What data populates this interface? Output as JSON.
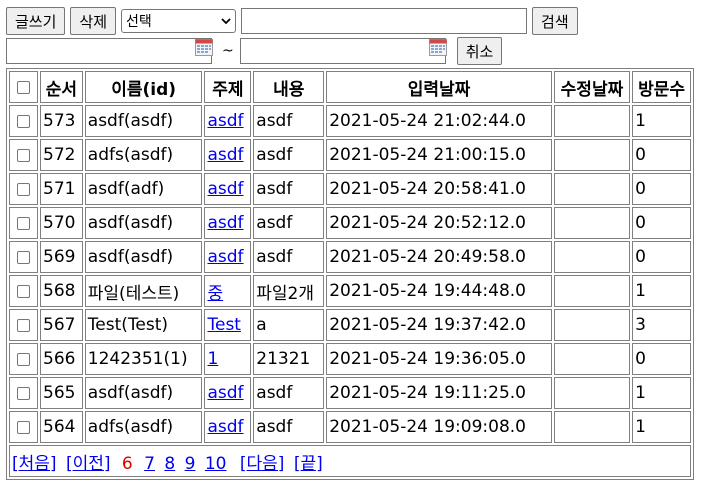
{
  "toolbar": {
    "write_label": "글쓰기",
    "delete_label": "삭제",
    "select_value": "선택",
    "search_value": "",
    "search_label": "검색",
    "cancel_label": "취소",
    "date_from": "",
    "date_to": "",
    "tilde": "~"
  },
  "table": {
    "headers": {
      "no": "순서",
      "name": "이름(id)",
      "subject": "주제",
      "content": "내용",
      "created": "입력날짜",
      "modified": "수정날짜",
      "views": "방문수"
    },
    "rows": [
      {
        "no": "573",
        "name": "asdf(asdf)",
        "subject": "asdf",
        "content": "asdf",
        "created": "2021-05-24 21:02:44.0",
        "modified": "",
        "views": "1"
      },
      {
        "no": "572",
        "name": "adfs(asdf)",
        "subject": "asdf",
        "content": "asdf",
        "created": "2021-05-24 21:00:15.0",
        "modified": "",
        "views": "0"
      },
      {
        "no": "571",
        "name": "asdf(adf)",
        "subject": "asdf",
        "content": "asdf",
        "created": "2021-05-24 20:58:41.0",
        "modified": "",
        "views": "0"
      },
      {
        "no": "570",
        "name": "asdf(asdf)",
        "subject": "asdf",
        "content": "asdf",
        "created": "2021-05-24 20:52:12.0",
        "modified": "",
        "views": "0"
      },
      {
        "no": "569",
        "name": "asdf(asdf)",
        "subject": "asdf",
        "content": "asdf",
        "created": "2021-05-24 20:49:58.0",
        "modified": "",
        "views": "0"
      },
      {
        "no": "568",
        "name": "파일(테스트)",
        "subject": "중",
        "content": "파일2개",
        "created": "2021-05-24 19:44:48.0",
        "modified": "",
        "views": "1"
      },
      {
        "no": "567",
        "name": "Test(Test)",
        "subject": "Test",
        "content": "a",
        "created": "2021-05-24 19:37:42.0",
        "modified": "",
        "views": "3"
      },
      {
        "no": "566",
        "name": "1242351(1)",
        "subject": "1",
        "content": "21321",
        "created": "2021-05-24 19:36:05.0",
        "modified": "",
        "views": "0"
      },
      {
        "no": "565",
        "name": "asdf(asdf)",
        "subject": "asdf",
        "content": "asdf",
        "created": "2021-05-24 19:11:25.0",
        "modified": "",
        "views": "1"
      },
      {
        "no": "564",
        "name": "adfs(asdf)",
        "subject": "asdf",
        "content": "asdf",
        "created": "2021-05-24 19:09:08.0",
        "modified": "",
        "views": "1"
      }
    ]
  },
  "pager": {
    "first": "[처음]",
    "prev": "[이전]",
    "current": "6",
    "pages": [
      "7",
      "8",
      "9",
      "10"
    ],
    "next": "[다음]",
    "last": "[끝]"
  },
  "colors": {
    "link": "#0000ee",
    "current_page": "#e00000",
    "border": "#808080"
  }
}
